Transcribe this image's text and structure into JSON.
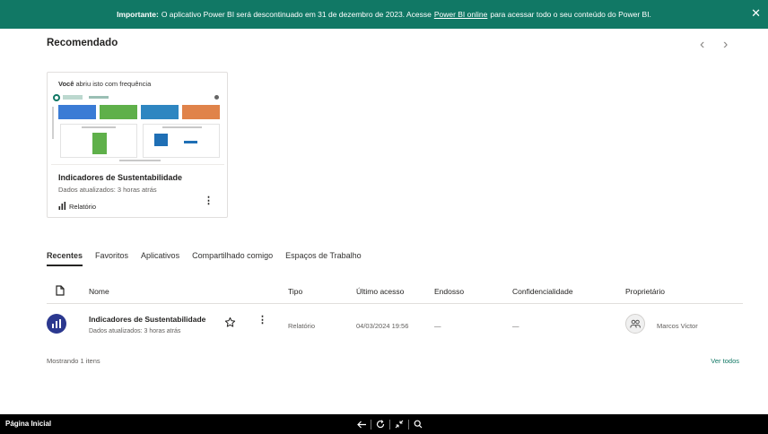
{
  "banner": {
    "bold": "Importante:",
    "text_before": "O aplicativo Power BI será descontinuado em 31 de dezembro de 2023. Acesse",
    "link": "Power BI online",
    "text_after": "para acessar todo o seu conteúdo do Power BI.",
    "close": "✕"
  },
  "recommended": {
    "title": "Recomendado",
    "prev": "‹",
    "next": "›",
    "card": {
      "freq_bold": "Você",
      "freq_rest": "abriu isto com frequência",
      "name": "Indicadores de Sustentabilidade",
      "updated": "Dados atualizados: 3 horas atrás",
      "type": "Relatório",
      "more": "⋮"
    }
  },
  "tabs": [
    "Recentes",
    "Favoritos",
    "Aplicativos",
    "Compartilhado comigo",
    "Espaços de Trabalho"
  ],
  "table": {
    "headers": {
      "name": "Nome",
      "type": "Tipo",
      "last_access": "Último acesso",
      "endorsement": "Endosso",
      "sensitivity": "Confidencialidade",
      "owner": "Proprietário"
    },
    "rows": [
      {
        "name": "Indicadores de Sustentabilidade",
        "updated": "Dados atualizados: 3 horas atrás",
        "more": "⋮",
        "type": "Relatório",
        "last_access": "04/03/2024 19:56",
        "endorsement": "—",
        "sensitivity": "—",
        "owner": "Marcos Victor"
      }
    ]
  },
  "footer": {
    "showing": "Mostrando 1 itens",
    "see_all": "Ver todos"
  },
  "taskbar": {
    "title": "Página Inicial"
  },
  "colors": {
    "banner": "#117865",
    "accent": "#117865",
    "report_icon": "#2b388f",
    "taskbar": "#000000"
  },
  "icons": [
    "close-icon",
    "chevron-left-icon",
    "chevron-right-icon",
    "bar-chart-icon",
    "more-icon",
    "file-icon",
    "report-icon",
    "star-icon",
    "people-icon",
    "back-arrow-icon",
    "refresh-icon",
    "collapse-icon",
    "search-icon"
  ]
}
